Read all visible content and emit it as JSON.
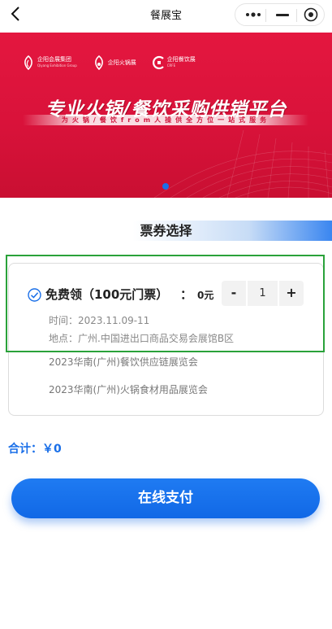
{
  "nav": {
    "title": "餐展宝",
    "back_icon": "chevron-left-icon",
    "more_icon": "more-dots-icon",
    "minimize_icon": "minimize-icon",
    "close_icon": "target-circle-icon"
  },
  "banner": {
    "logos": [
      {
        "name": "企阳会展集团",
        "sub": "Qiyang Exhibition Group"
      },
      {
        "name": "企阳火锅展",
        "sub": ""
      },
      {
        "name": "企阳餐饮展",
        "sub": "CRFE"
      }
    ],
    "headline": "专业火锅/餐饮采购供销平台",
    "subline": "为火锅/餐饮from人操供全方位一站式服务",
    "carousel_count": 1,
    "carousel_active": 0,
    "bg_color": "#e4173f"
  },
  "section": {
    "title": "票券选择"
  },
  "ticket": {
    "checked": true,
    "name": "免费领（100元门票）",
    "colon": "：",
    "price": "0元",
    "quantity": "1",
    "minus_label": "-",
    "plus_label": "+",
    "time": "时间：2023.11.09-11",
    "place": "地点：广州.中国进出口商品交易会展馆B区",
    "exhibitions": [
      "2023华南(广州)餐饮供应链展览会",
      "2023华南(广州)火锅食材用品展览会"
    ]
  },
  "summary": {
    "total": "合计：￥0"
  },
  "pay_button": {
    "label": "在线支付",
    "color": "#1a6fe8"
  }
}
